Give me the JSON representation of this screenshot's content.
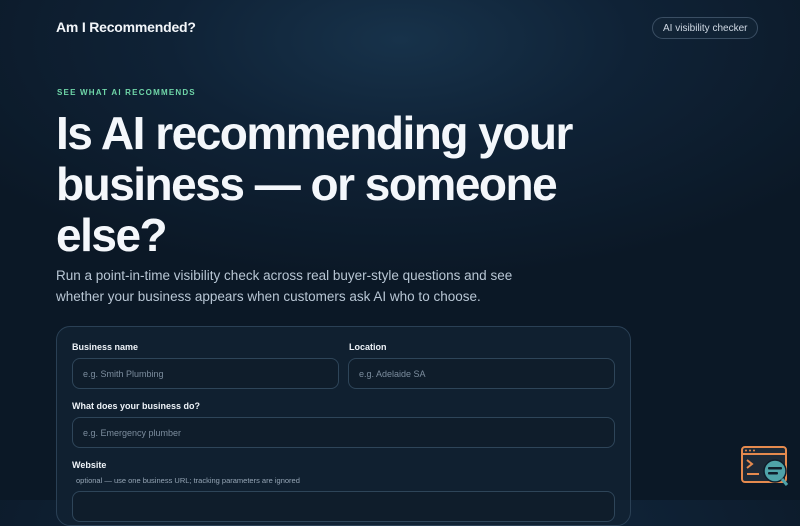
{
  "header": {
    "brand": "Am I Recommended?",
    "badge": "AI visibility checker"
  },
  "hero": {
    "eyebrow": "SEE WHAT AI RECOMMENDS",
    "headline": "Is AI recommending your business — or someone else?",
    "subtext": "Run a point-in-time visibility check across real buyer-style questions and see whether your business appears when customers ask AI who to choose."
  },
  "form": {
    "business_name": {
      "label": "Business name",
      "placeholder": "e.g. Smith Plumbing"
    },
    "location": {
      "label": "Location",
      "placeholder": "e.g. Adelaide SA"
    },
    "what_do": {
      "label": "What does your business do?",
      "placeholder": "e.g. Emergency plumber"
    },
    "website": {
      "label": "Website",
      "hint": "optional — use one business URL; tracking parameters are ignored"
    }
  },
  "widget": {
    "icon": "support-chat-icon"
  },
  "colors": {
    "accent": "#6fd6a8",
    "background": "#0f2236",
    "widget_orange": "#e58a4e",
    "widget_teal": "#4fa3a9"
  }
}
